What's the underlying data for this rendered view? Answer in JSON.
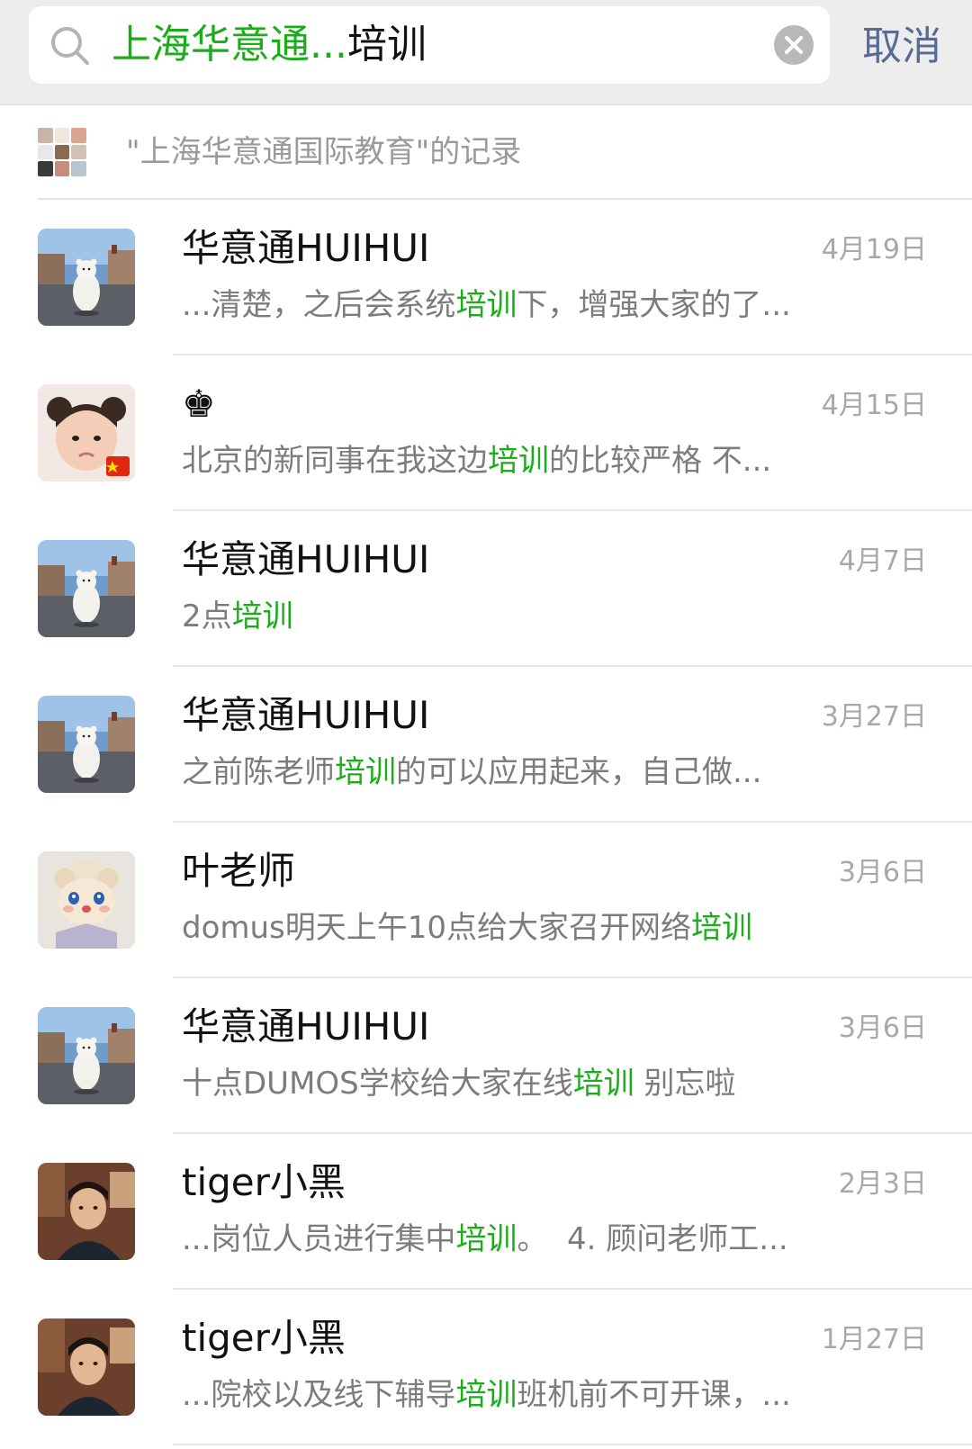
{
  "search": {
    "query_prefix": "上海华意通...",
    "query_keyword": "培训",
    "cancel_label": "取消"
  },
  "group_record": {
    "label": "\"上海华意通国际教育\"的记录"
  },
  "results": [
    {
      "name": "华意通HUIHUI",
      "date": "4月19日",
      "avatar": "polar-bear",
      "snippet_before": "...清楚，之后会系统",
      "keyword": "培训",
      "snippet_after": "下，增强大家的了..."
    },
    {
      "name": "♚",
      "date": "4月15日",
      "avatar": "baby-girl",
      "snippet_before": "北京的新同事在我这边",
      "keyword": "培训",
      "snippet_after": "的比较严格 不..."
    },
    {
      "name": "华意通HUIHUI",
      "date": "4月7日",
      "avatar": "polar-bear",
      "snippet_before": "2点",
      "keyword": "培训",
      "snippet_after": ""
    },
    {
      "name": "华意通HUIHUI",
      "date": "3月27日",
      "avatar": "polar-bear",
      "snippet_before": "之前陈老师",
      "keyword": "培训",
      "snippet_after": "的可以应用起来，自己做..."
    },
    {
      "name": "叶老师",
      "date": "3月6日",
      "avatar": "lamb-doll",
      "snippet_before": "domus明天上午10点给大家召开网络",
      "keyword": "培训",
      "snippet_after": ""
    },
    {
      "name": "华意通HUIHUI",
      "date": "3月6日",
      "avatar": "polar-bear",
      "snippet_before": "十点DUMOS学校给大家在线",
      "keyword": "培训",
      "snippet_after": " 别忘啦"
    },
    {
      "name": "tiger小黑",
      "date": "2月3日",
      "avatar": "young-man",
      "snippet_before": "...岗位人员进行集中",
      "keyword": "培训",
      "snippet_after": "。  4. 顾问老师工..."
    },
    {
      "name": "tiger小黑",
      "date": "1月27日",
      "avatar": "young-man",
      "snippet_before": "...院校以及线下辅导",
      "keyword": "培训",
      "snippet_after": "班机前不可开课，..."
    }
  ],
  "colors": {
    "highlight": "#1aad19",
    "cancel": "#576b95",
    "secondary_text": "#7c7c7c"
  }
}
